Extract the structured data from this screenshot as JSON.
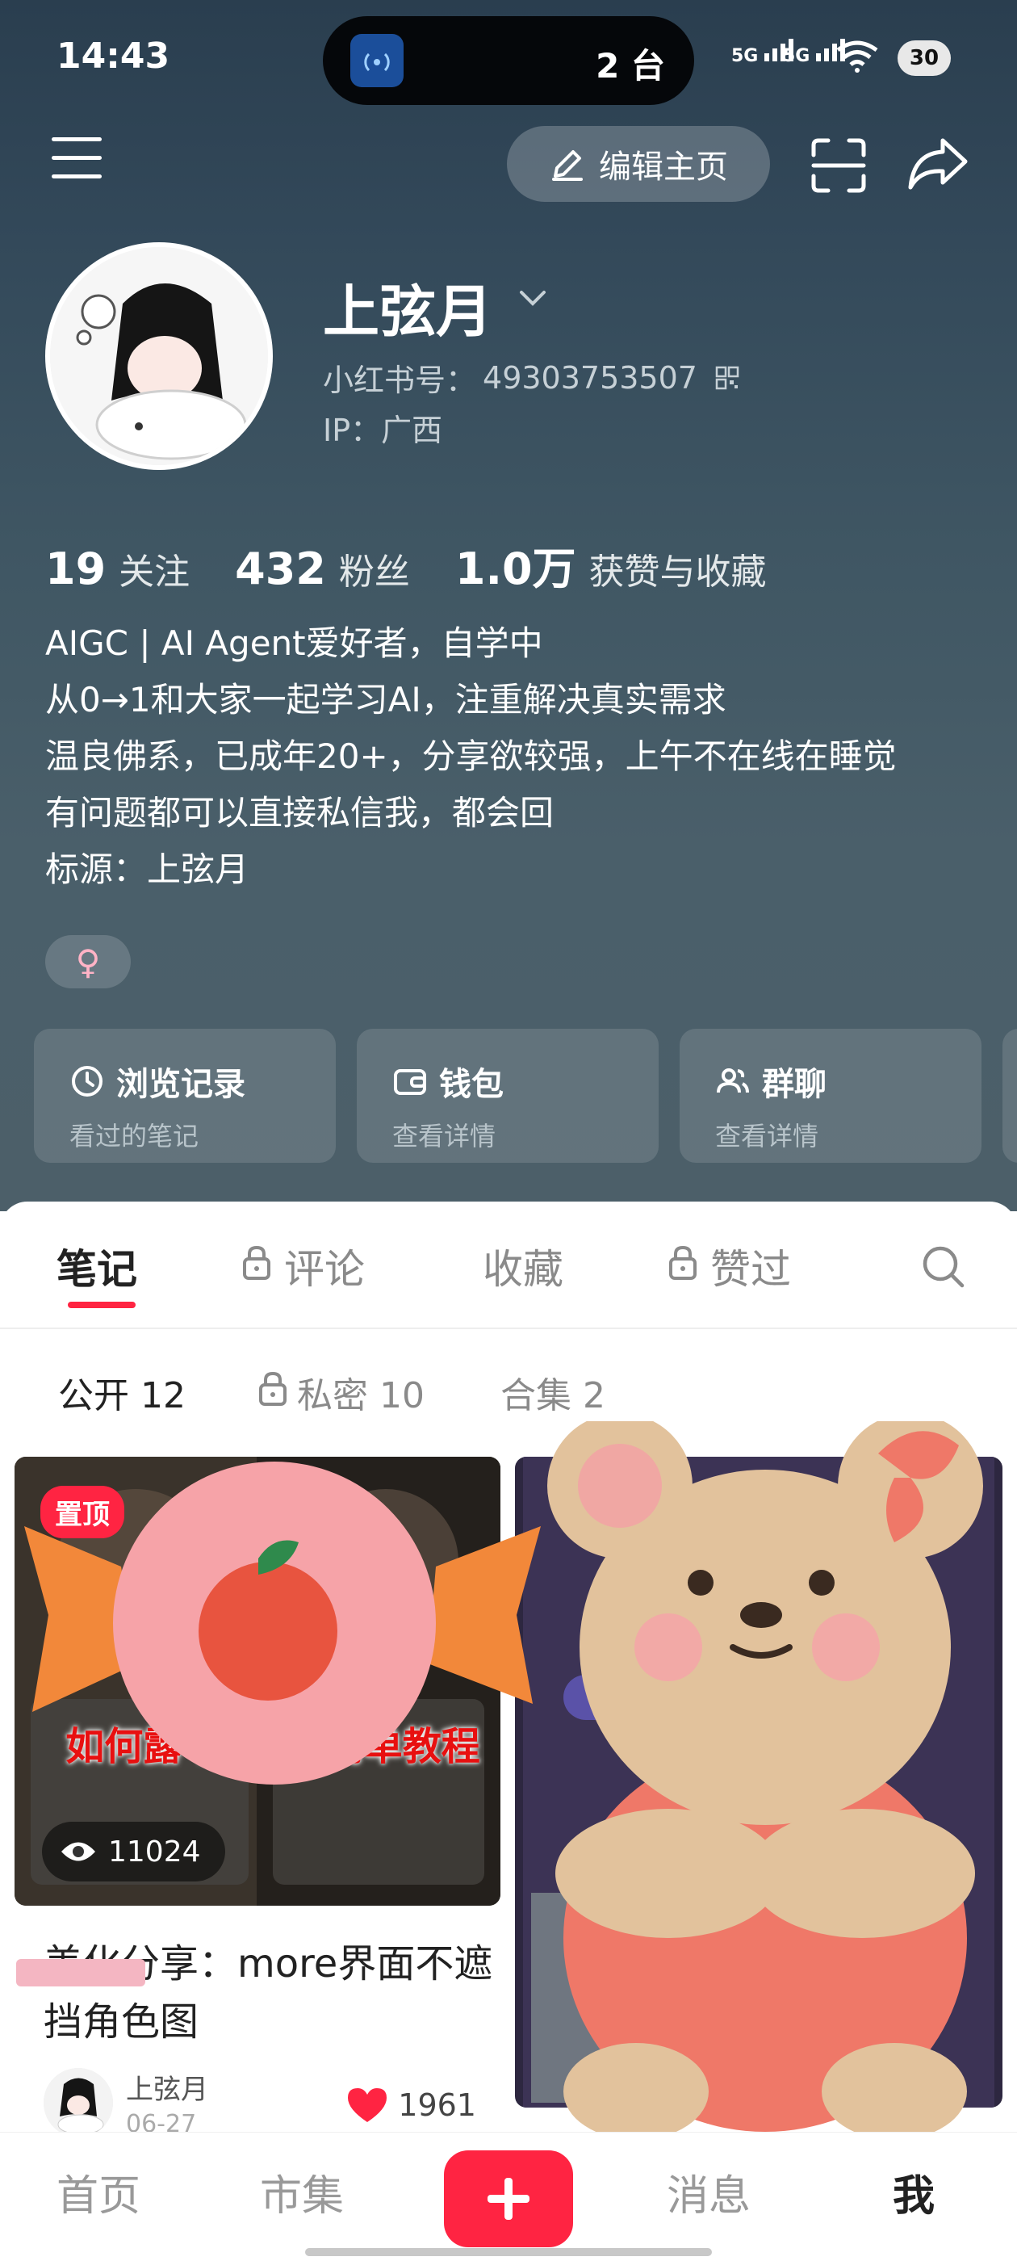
{
  "status_bar": {
    "time": "14:43",
    "island_text": "2 台",
    "island_badge": "2",
    "signal_1": "5G",
    "signal_2": "5G",
    "battery": "30"
  },
  "nav": {
    "edit_label": "编辑主页"
  },
  "profile": {
    "username": "上弦月",
    "id_label": "小红书号：",
    "id_value": "49303753507",
    "ip": "IP：广西",
    "stats": [
      {
        "num": "19",
        "label": "关注"
      },
      {
        "num": "432",
        "label": "粉丝"
      },
      {
        "num": "1.0万",
        "label": "获赞与收藏"
      }
    ],
    "bio": [
      "AIGC | AI Agent爱好者，自学中",
      "从0→1和大家一起学习AI，注重解决真实需求",
      "温良佛系，已成年20+，分享欲较强，上午不在线在睡觉",
      "有问题都可以直接私信我，都会回",
      "标源：上弦月"
    ],
    "gender_symbol": "♀"
  },
  "cards": [
    {
      "title": "浏览记录",
      "sub": "看过的笔记",
      "icon": "clock-icon"
    },
    {
      "title": "钱包",
      "sub": "查看详情",
      "icon": "wallet-icon"
    },
    {
      "title": "群聊",
      "sub": "查看详情",
      "icon": "group-icon"
    }
  ],
  "tabs": [
    {
      "label": "笔记",
      "locked": false,
      "active": true
    },
    {
      "label": "评论",
      "locked": true,
      "active": false
    },
    {
      "label": "收藏",
      "locked": false,
      "active": false
    },
    {
      "label": "赞过",
      "locked": true,
      "active": false
    }
  ],
  "subtabs": [
    {
      "label": "公开 12",
      "active": true
    },
    {
      "label": "私密 10",
      "active": false
    },
    {
      "label": "合集 2",
      "active": false
    }
  ],
  "notes": [
    {
      "pin_label": "置顶",
      "overlay_text": "如何露 帅脸 超简单教程",
      "views": "11024",
      "title": "美化分享：more界面不遮挡角色图",
      "author": "上弦月",
      "date": "06-27",
      "likes": "1961",
      "colors": {
        "accent": "#ff2442"
      }
    }
  ],
  "bottom_nav": {
    "home": "首页",
    "market": "市集",
    "messages": "消息",
    "me": "我"
  },
  "colors": {
    "brand": "#ff2442",
    "header": "#3f5663"
  }
}
